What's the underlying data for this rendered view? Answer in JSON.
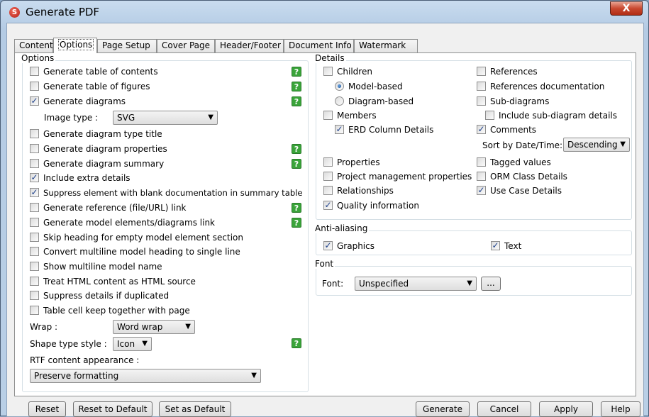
{
  "window": {
    "title": "Generate PDF",
    "close_label": "X"
  },
  "tabs": [
    "Content",
    "Options",
    "Page Setup",
    "Cover Page",
    "Header/Footer",
    "Document Info",
    "Watermark"
  ],
  "options": {
    "title": "Options",
    "items": [
      {
        "label": "Generate table of contents",
        "checked": false,
        "help": true
      },
      {
        "label": "Generate table of figures",
        "checked": false,
        "help": true
      },
      {
        "label": "Generate diagrams",
        "checked": true,
        "help": true
      },
      {
        "label": "Generate diagram type title",
        "checked": false,
        "help": false
      },
      {
        "label": "Generate diagram properties",
        "checked": false,
        "help": true
      },
      {
        "label": "Generate diagram summary",
        "checked": false,
        "help": true
      },
      {
        "label": "Include extra details",
        "checked": true,
        "help": false
      },
      {
        "label": "Suppress element with blank documentation in summary table",
        "checked": true,
        "help": false
      },
      {
        "label": "Generate reference (file/URL) link",
        "checked": false,
        "help": true
      },
      {
        "label": "Generate model elements/diagrams link",
        "checked": false,
        "help": true
      },
      {
        "label": "Skip heading for empty model element section",
        "checked": false,
        "help": false
      },
      {
        "label": "Convert multiline model heading to single line",
        "checked": false,
        "help": false
      },
      {
        "label": "Show multiline model name",
        "checked": false,
        "help": false
      },
      {
        "label": "Treat HTML content as HTML source",
        "checked": false,
        "help": false
      },
      {
        "label": "Suppress details if duplicated",
        "checked": false,
        "help": false
      },
      {
        "label": "Table cell keep together with page",
        "checked": false,
        "help": false
      }
    ],
    "image_type_label": "Image type :",
    "image_type_value": "SVG",
    "wrap_label": "Wrap :",
    "wrap_value": "Word wrap",
    "shape_type_label": "Shape type style :",
    "shape_type_value": "Icon",
    "rtf_label": "RTF content appearance :",
    "rtf_value": "Preserve formatting",
    "help_glyph": "?"
  },
  "details": {
    "title": "Details",
    "left": {
      "children": "Children",
      "model_based": "Model-based",
      "diagram_based": "Diagram-based",
      "members": "Members",
      "erd": "ERD Column Details",
      "properties": "Properties",
      "pm_properties": "Project management properties",
      "relationships": "Relationships",
      "quality": "Quality information"
    },
    "right": {
      "references": "References",
      "references_doc": "References documentation",
      "sub_diagrams": "Sub-diagrams",
      "include_sub": "Include sub-diagram details",
      "comments": "Comments",
      "sort_label": "Sort by Date/Time:",
      "sort_value": "Descending",
      "tagged": "Tagged values",
      "orm": "ORM Class Details",
      "use_case": "Use Case Details"
    },
    "check_glyph": "✓"
  },
  "antialiasing": {
    "title": "Anti-aliasing",
    "graphics": "Graphics",
    "text": "Text"
  },
  "font": {
    "title": "Font",
    "label": "Font:",
    "value": "Unspecified",
    "browse": "..."
  },
  "buttons": {
    "reset": "Reset",
    "reset_default": "Reset to Default",
    "set_default": "Set as Default",
    "generate": "Generate",
    "cancel": "Cancel",
    "apply": "Apply",
    "help": "Help"
  }
}
